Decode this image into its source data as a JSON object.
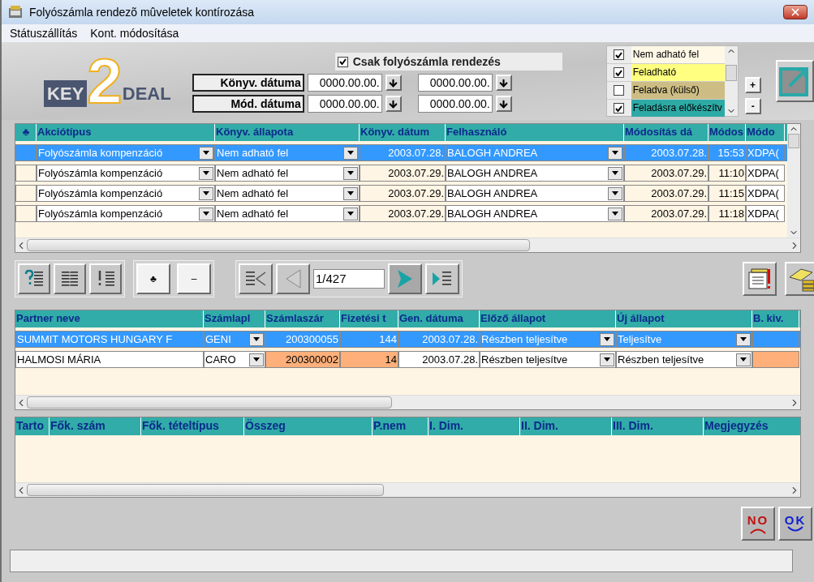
{
  "window": {
    "title": "Folyószámla rendezõ mûveletek kontírozása"
  },
  "menu": [
    "Státuszállítás",
    "Kont. módosítása"
  ],
  "logo": {
    "left": "KEY",
    "digit": "2",
    "right": "DEAL"
  },
  "filters": {
    "only_checkbox": {
      "label": "Csak folyószámla rendezés",
      "checked": true
    },
    "date_rows": [
      {
        "label": "Könyv. dátuma",
        "from": "0000.00.00.",
        "to": "0000.00.00."
      },
      {
        "label": "Mód. dátuma",
        "from": "0000.00.00.",
        "to": "0000.00.00."
      }
    ]
  },
  "status_list": [
    {
      "label": "Nem adható fel",
      "checked": true,
      "color": "#fff8e6"
    },
    {
      "label": "Feladható",
      "checked": true,
      "color": "#ffff80"
    },
    {
      "label": "Feladva (külső)",
      "checked": false,
      "color": "#cdbd84"
    },
    {
      "label": "Feladásra előkészítv",
      "checked": true,
      "color": "#2eaaa6"
    }
  ],
  "list_buttons": [
    "+",
    "-"
  ],
  "actions_grid": {
    "columns": [
      {
        "label": "♣",
        "kind": "marker"
      },
      {
        "label": "Akciótípus",
        "kind": "combo"
      },
      {
        "label": "Könyv. állapota",
        "kind": "combo"
      },
      {
        "label": "Könyv. dátum",
        "kind": "number"
      },
      {
        "label": "Felhasználó",
        "kind": "combo"
      },
      {
        "label": "Módosítás dá",
        "kind": "number"
      },
      {
        "label": "Módos",
        "kind": "number"
      },
      {
        "label": "Módo",
        "kind": "text"
      }
    ],
    "rows": [
      {
        "selected": true,
        "cells": [
          "",
          "Folyószámla kompenzáció",
          "Nem adható fel",
          "2003.07.28.",
          "BALOGH ANDREA",
          "2003.07.28.",
          "15:53",
          "XDPA("
        ]
      },
      {
        "selected": false,
        "cells": [
          "",
          "Folyószámla kompenzáció",
          "Nem adható fel",
          "2003.07.29.",
          "BALOGH ANDREA",
          "2003.07.29.",
          "11:10",
          "XDPA("
        ]
      },
      {
        "selected": false,
        "cells": [
          "",
          "Folyószámla kompenzáció",
          "Nem adható fel",
          "2003.07.29.",
          "BALOGH ANDREA",
          "2003.07.29.",
          "11:15",
          "XDPA("
        ]
      },
      {
        "selected": false,
        "cells": [
          "",
          "Folyószámla kompenzáció",
          "Nem adható fel",
          "2003.07.29.",
          "BALOGH ANDREA",
          "2003.07.29.",
          "11:18",
          "XDPA("
        ]
      }
    ]
  },
  "toolbar": {
    "text_buttons": [
      "♣",
      "–"
    ],
    "pager": "1/427"
  },
  "partner_grid": {
    "columns": [
      {
        "label": "Partner neve",
        "kind": "text"
      },
      {
        "label": "Számlapl",
        "kind": "combo"
      },
      {
        "label": "Számlaszár",
        "kind": "number"
      },
      {
        "label": "Fizetési t",
        "kind": "number"
      },
      {
        "label": "Gen. dátuma",
        "kind": "number"
      },
      {
        "label": "Előző állapot",
        "kind": "combo"
      },
      {
        "label": "Új állapot",
        "kind": "combo"
      },
      {
        "label": "B. kiv.",
        "kind": "text"
      }
    ],
    "rows": [
      {
        "selected": true,
        "cells": [
          {
            "text": "SUMMIT MOTORS HUNGARY F",
            "highlight": false
          },
          {
            "text": "GENI",
            "highlight": false
          },
          {
            "text": "200300055",
            "highlight": false
          },
          {
            "text": "144",
            "highlight": false
          },
          {
            "text": "2003.07.28.",
            "highlight": false
          },
          {
            "text": "Részben teljesítve",
            "highlight": false
          },
          {
            "text": "Teljesítve",
            "highlight": false
          },
          {
            "highlight": false
          }
        ]
      },
      {
        "selected": false,
        "cells": [
          {
            "text": "HALMOSI MÁRIA",
            "highlight": false
          },
          {
            "text": "CARO",
            "highlight": false
          },
          {
            "text": "200300002",
            "highlight": true
          },
          {
            "text": "14",
            "highlight": true
          },
          {
            "text": "2003.07.28.",
            "highlight": false
          },
          {
            "text": "Részben teljesítve",
            "highlight": false
          },
          {
            "text": "Részben teljesítve",
            "highlight": false
          },
          {
            "highlight": true
          }
        ]
      }
    ]
  },
  "ledger_grid": {
    "columns": [
      "Tarto",
      "Fők. szám",
      "Fők. tételtípus",
      "Összeg",
      "P.nem",
      "I. Dim.",
      "II. Dim.",
      "III. Dim.",
      "Megjegyzés"
    ]
  },
  "dialog_buttons": [
    {
      "kind": "no",
      "label": "NO"
    },
    {
      "kind": "ok",
      "label": "OK"
    }
  ]
}
